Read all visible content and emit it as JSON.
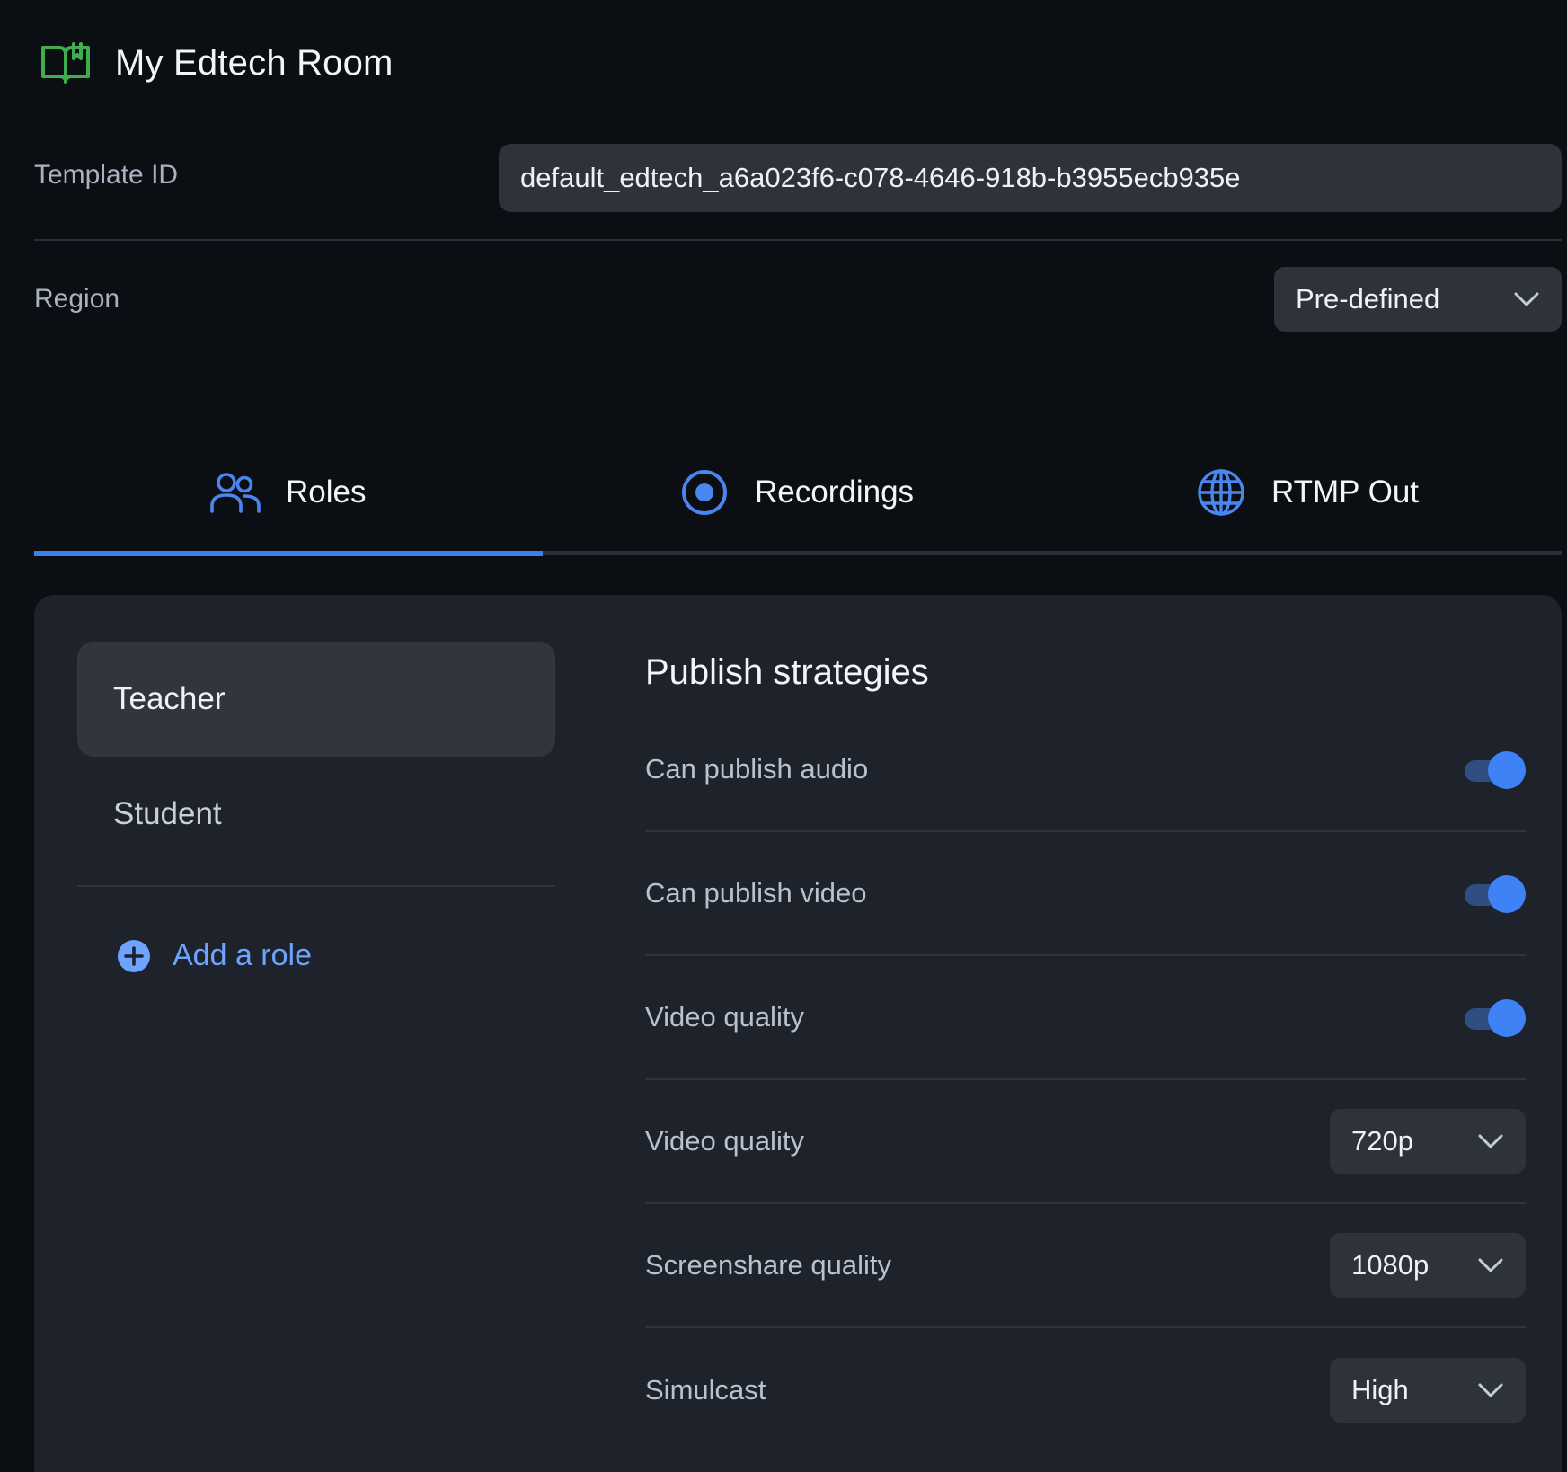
{
  "header": {
    "title": "My Edtech Room",
    "icon": "book-icon",
    "icon_color": "#3fae4f"
  },
  "template": {
    "label": "Template ID",
    "value": "default_edtech_a6a023f6-c078-4646-918b-b3955ecb935e"
  },
  "region": {
    "label": "Region",
    "value": "Pre-defined"
  },
  "tabs": [
    {
      "label": "Roles",
      "icon": "users-icon",
      "active": true
    },
    {
      "label": "Recordings",
      "icon": "record-icon",
      "active": false
    },
    {
      "label": "RTMP Out",
      "icon": "globe-icon",
      "active": false
    }
  ],
  "roles": {
    "items": [
      {
        "label": "Teacher",
        "selected": true
      },
      {
        "label": "Student",
        "selected": false
      }
    ],
    "add_label": "Add a role"
  },
  "settings": {
    "title": "Publish strategies",
    "rows": [
      {
        "label": "Can publish audio",
        "type": "toggle",
        "on": true
      },
      {
        "label": "Can publish video",
        "type": "toggle",
        "on": true
      },
      {
        "label": "Video quality",
        "type": "toggle",
        "on": true
      },
      {
        "label": "Video quality",
        "type": "select",
        "value": "720p"
      },
      {
        "label": "Screenshare quality",
        "type": "select",
        "value": "1080p"
      },
      {
        "label": "Simulcast",
        "type": "select",
        "value": "High"
      }
    ]
  },
  "colors": {
    "accent": "#3d7ff0",
    "background": "#0b0e13",
    "panel": "#1e222a"
  }
}
